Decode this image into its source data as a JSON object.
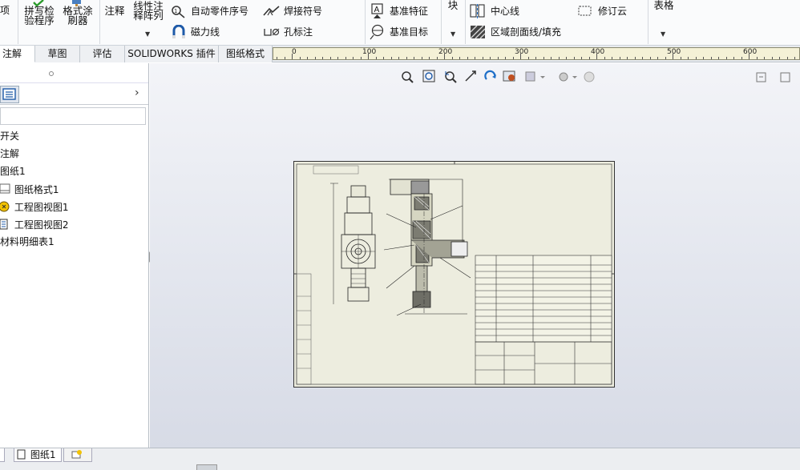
{
  "ribbon": {
    "partial_left": "项",
    "spell_check": "拼写检\n验程序",
    "format_painter": "格式涂\n刷器",
    "annotation": "注释",
    "linear_pattern": "线性注\n释阵列",
    "auto_balloon": "自动零件序号",
    "magnetic_line": "磁力线",
    "weld_symbol": "焊接符号",
    "hole_callout": "孔标注",
    "datum_feature": "基准特征",
    "datum_target": "基准目标",
    "block": "块",
    "center_line": "中心线",
    "area_hatch": "区域剖面线/填充",
    "revision_cloud": "修订云",
    "table": "表格"
  },
  "tabs": [
    {
      "label": "注解",
      "active": true
    },
    {
      "label": "草图",
      "active": false
    },
    {
      "label": "评估",
      "active": false
    },
    {
      "label": "SOLIDWORKS 插件",
      "active": false
    },
    {
      "label": "图纸格式",
      "active": false
    }
  ],
  "ruler": {
    "labels": [
      "0",
      "100",
      "200",
      "300",
      "400",
      "500",
      "600"
    ]
  },
  "tree": {
    "items": [
      {
        "label": "开关",
        "icon": "none"
      },
      {
        "label": "注解",
        "icon": "none"
      },
      {
        "label": "图纸1",
        "icon": "none"
      },
      {
        "label": "图纸格式1",
        "icon": "sheet-format-icon"
      },
      {
        "label": "工程图视图1",
        "icon": "drawing-view-icon"
      },
      {
        "label": "工程图视图2",
        "icon": "section-view-icon"
      },
      {
        "label": "材料明细表1",
        "icon": "none"
      }
    ]
  },
  "bottom": {
    "sheet_tab": "图纸1"
  },
  "colors": {
    "accent": "#1e6fc8",
    "sheet": "#ededdf",
    "ruler": "#f4f1d6"
  }
}
